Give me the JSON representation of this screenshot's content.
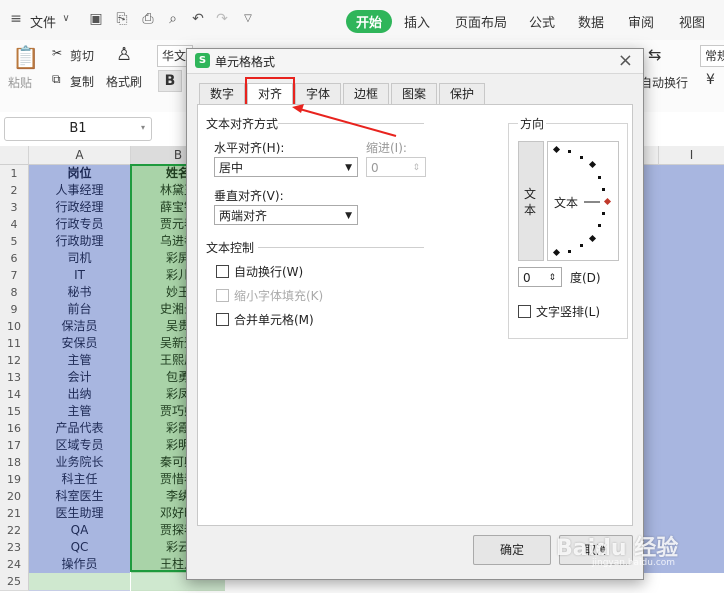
{
  "menubar": {
    "file_label": "文件",
    "tabs": [
      "开始",
      "插入",
      "页面布局",
      "公式",
      "数据",
      "审阅",
      "视图"
    ]
  },
  "ribbon": {
    "paste_label": "粘贴",
    "cut_label": "剪切",
    "copy_label": "复制",
    "format_painter_label": "格式刷",
    "font_name": "华文",
    "bold_label": "B",
    "wrap_label": "自动换行",
    "normal_label": "常规",
    "currency_label": "¥"
  },
  "namebox": {
    "value": "B1"
  },
  "grid": {
    "col_headers": [
      "A",
      "B",
      "I"
    ],
    "rows": [
      {
        "n": "1",
        "a": "岗位",
        "b": "姓名"
      },
      {
        "n": "2",
        "a": "人事经理",
        "b": "林黛玉"
      },
      {
        "n": "3",
        "a": "行政经理",
        "b": "薛宝钗"
      },
      {
        "n": "4",
        "a": "行政专员",
        "b": "贾元春"
      },
      {
        "n": "5",
        "a": "行政助理",
        "b": "乌进孝"
      },
      {
        "n": "6",
        "a": "司机",
        "b": "彩屏"
      },
      {
        "n": "7",
        "a": "IT",
        "b": "彩儿"
      },
      {
        "n": "8",
        "a": "秘书",
        "b": "妙玉"
      },
      {
        "n": "9",
        "a": "前台",
        "b": "史湘云"
      },
      {
        "n": "10",
        "a": "保洁员",
        "b": "吴贵"
      },
      {
        "n": "11",
        "a": "安保员",
        "b": "吴新登"
      },
      {
        "n": "12",
        "a": "主管",
        "b": "王熙凤"
      },
      {
        "n": "13",
        "a": "会计",
        "b": "包勇"
      },
      {
        "n": "14",
        "a": "出纳",
        "b": "彩凤"
      },
      {
        "n": "15",
        "a": "主管",
        "b": "贾巧姐"
      },
      {
        "n": "16",
        "a": "产品代表",
        "b": "彩霞"
      },
      {
        "n": "17",
        "a": "区域专员",
        "b": "彩明"
      },
      {
        "n": "18",
        "a": "业务院长",
        "b": "秦可卿"
      },
      {
        "n": "19",
        "a": "科主任",
        "b": "贾惜春"
      },
      {
        "n": "20",
        "a": "科室医生",
        "b": "李纨"
      },
      {
        "n": "21",
        "a": "医生助理",
        "b": "邓好时"
      },
      {
        "n": "22",
        "a": "QA",
        "b": "贾探春"
      },
      {
        "n": "23",
        "a": "QC",
        "b": "彩云"
      },
      {
        "n": "24",
        "a": "操作员",
        "b": "王柱儿"
      },
      {
        "n": "25",
        "a": "",
        "b": ""
      }
    ]
  },
  "dialog": {
    "title": "单元格格式",
    "tabs": [
      "数字",
      "对齐",
      "字体",
      "边框",
      "图案",
      "保护"
    ],
    "text_align_section": "文本对齐方式",
    "h_align_label": "水平对齐(H):",
    "h_align_value": "居中",
    "indent_label": "缩进(I):",
    "indent_value": "0",
    "v_align_label": "垂直对齐(V):",
    "v_align_value": "两端对齐",
    "text_control_section": "文本控制",
    "wrap_text_label": "自动换行(W)",
    "shrink_label": "缩小字体填充(K)",
    "merge_label": "合并单元格(M)",
    "orientation_section": "方向",
    "vertical_text": "文本",
    "orientation_text": "文本",
    "degree_value": "0",
    "degree_label": "度(D)",
    "vertical_text_label": "文字竖排(L)",
    "ok_label": "确定",
    "cancel_label": "取消"
  },
  "watermark": {
    "text": "Baidu 经验",
    "sub": "jingyan.baidu.com"
  },
  "colors": {
    "accent": "#2fb55a",
    "highlight": "#e8231e",
    "col_a": "#a8b6e0",
    "col_b": "#a9d3a8"
  }
}
